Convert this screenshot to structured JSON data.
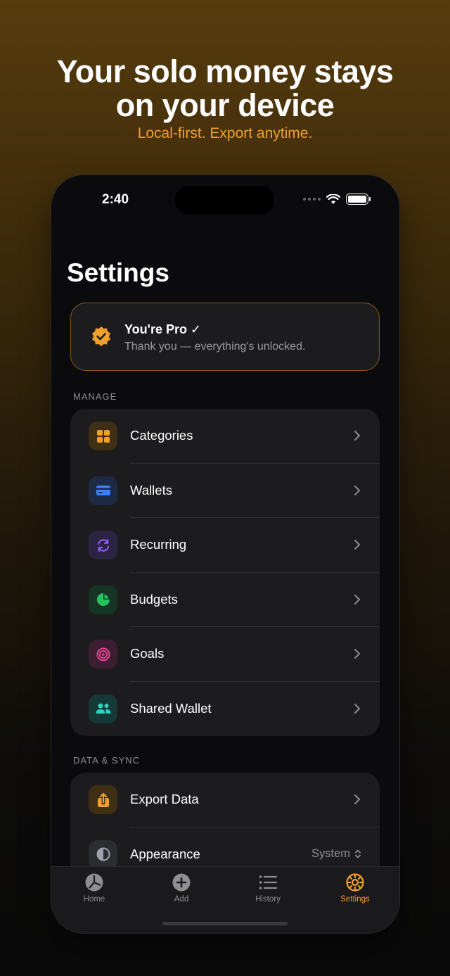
{
  "promo": {
    "headline_line1": "Your solo money stays",
    "headline_line2": "on your device",
    "subhead": "Local-first. Export anytime."
  },
  "status_bar": {
    "time": "2:40"
  },
  "screen": {
    "title": "Settings"
  },
  "pro_card": {
    "title": "You're Pro ✓",
    "subtitle": "Thank you — everything's unlocked."
  },
  "sections": {
    "manage": {
      "label": "MANAGE",
      "items": [
        {
          "label": "Categories",
          "icon": "grid-icon",
          "color": "#f2a02c"
        },
        {
          "label": "Wallets",
          "icon": "card-icon",
          "color": "#3b82f6"
        },
        {
          "label": "Recurring",
          "icon": "repeat-icon",
          "color": "#8b5cf6"
        },
        {
          "label": "Budgets",
          "icon": "pie-chart-icon",
          "color": "#22c55e"
        },
        {
          "label": "Goals",
          "icon": "target-icon",
          "color": "#ec4899"
        },
        {
          "label": "Shared Wallet",
          "icon": "people-icon",
          "color": "#2dd4bf"
        }
      ]
    },
    "data_sync": {
      "label": "DATA & SYNC",
      "items": [
        {
          "label": "Export Data",
          "icon": "share-icon",
          "color": "#f2a02c"
        },
        {
          "label": "Appearance",
          "icon": "contrast-icon",
          "color": "#9ca3af",
          "value": "System"
        }
      ]
    }
  },
  "tabbar": {
    "items": [
      {
        "label": "Home",
        "icon": "pie-icon"
      },
      {
        "label": "Add",
        "icon": "plus-circle-icon"
      },
      {
        "label": "History",
        "icon": "list-icon"
      },
      {
        "label": "Settings",
        "icon": "gear-icon",
        "active": true
      }
    ]
  },
  "colors": {
    "accent": "#f2a02c",
    "background": "#0b0b0d",
    "card": "#1c1c1e"
  }
}
